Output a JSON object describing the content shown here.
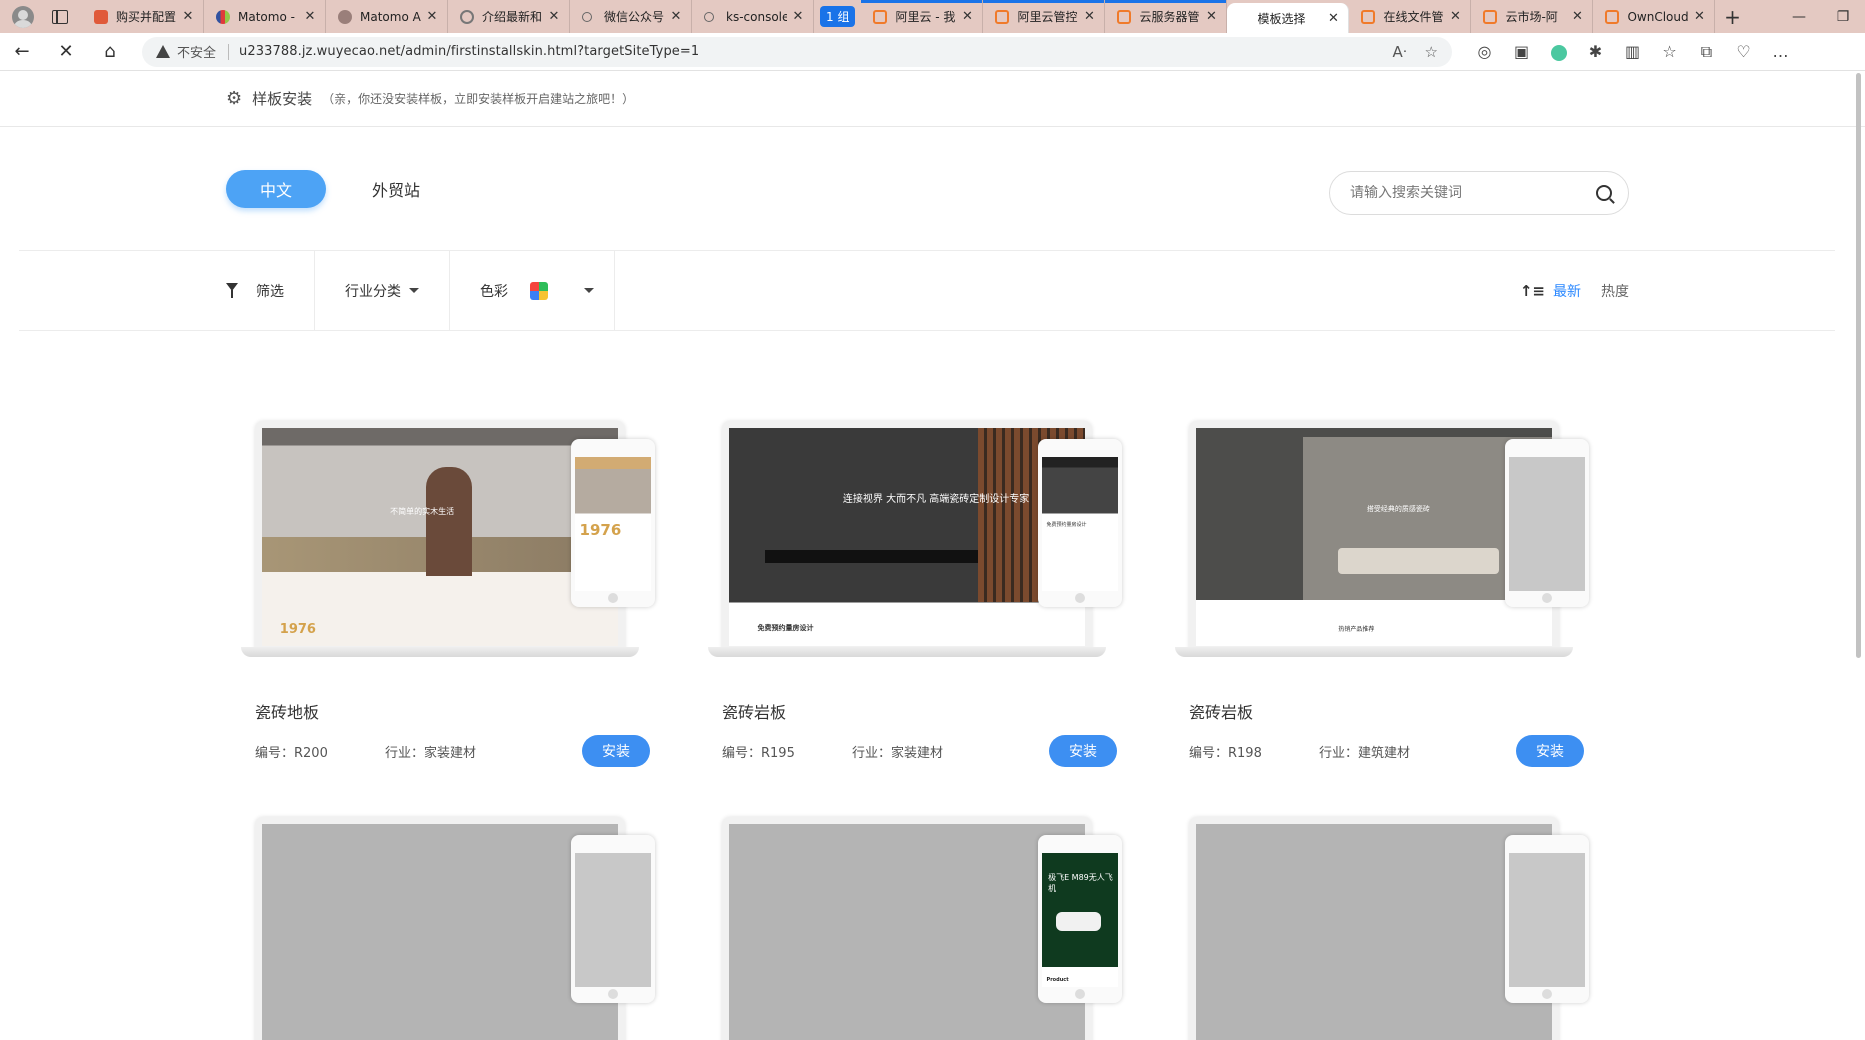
{
  "browser": {
    "tabs": [
      {
        "title": "购买并配置",
        "icon": "red"
      },
      {
        "title": "Matomo -",
        "icon": "matomo"
      },
      {
        "title": "Matomo A",
        "icon": "avatar-s"
      },
      {
        "title": "介绍最新和",
        "icon": "grey"
      },
      {
        "title": "微信公众号",
        "icon": "search"
      },
      {
        "title": "ks-console",
        "icon": "search"
      },
      {
        "title": "阿里云 - 我",
        "icon": "orange"
      },
      {
        "title": "阿里云管控",
        "icon": "orange"
      },
      {
        "title": "云服务器管",
        "icon": "orange"
      },
      {
        "title": "模板选择",
        "icon": "none"
      },
      {
        "title": "在线文件管",
        "icon": "orange"
      },
      {
        "title": "云市场-阿",
        "icon": "orange"
      },
      {
        "title": "OwnCloud",
        "icon": "orange"
      }
    ],
    "group_label": "1 组",
    "insecure_label": "不安全",
    "url": "u233788.jz.wuyecao.net/admin/firstinstallskin.html?targetSiteType=1"
  },
  "header": {
    "title": "样板安装",
    "subtitle": "（亲，你还没安装样板，立即安装样板开启建站之旅吧！）"
  },
  "lang": {
    "active": "中文",
    "other": "外贸站"
  },
  "search": {
    "placeholder": "请输入搜索关键词",
    "value": ""
  },
  "filters": {
    "filter_label": "筛选",
    "industry_label": "行业分类",
    "color_label": "色彩",
    "color_swatch": [
      "#f5453d",
      "#2ebd59",
      "#3b7ff5",
      "#f7c331"
    ]
  },
  "sort": {
    "newest": "最新",
    "hottest": "热度",
    "active_color": "#2b88ff"
  },
  "templates": [
    {
      "name": "瓷砖地板",
      "code": "编号：R200",
      "industry": "行业：家装建材",
      "install": "安装",
      "laptop_caption": "不简单的实木生活",
      "laptop_year": "1976",
      "phone_year": "1976"
    },
    {
      "name": "瓷砖岩板",
      "code": "编号：R195",
      "industry": "行业：家装建材",
      "install": "安装",
      "laptop_caption": "连接视界 大而不凡 高端瓷砖定制设计专家",
      "laptop_bottom": "免费预约量房设计",
      "phone_text": "免费预约量房设计"
    },
    {
      "name": "瓷砖岩板",
      "code": "编号：R198",
      "industry": "行业：建筑建材",
      "install": "安装",
      "laptop_caption": "搭受经典的质感瓷砖",
      "laptop_bottom": "热销产品推荐"
    },
    {
      "phone_caption": "极飞E M89无人飞机",
      "phone_bottom": "Product"
    }
  ],
  "accent": "#3d8ff2"
}
